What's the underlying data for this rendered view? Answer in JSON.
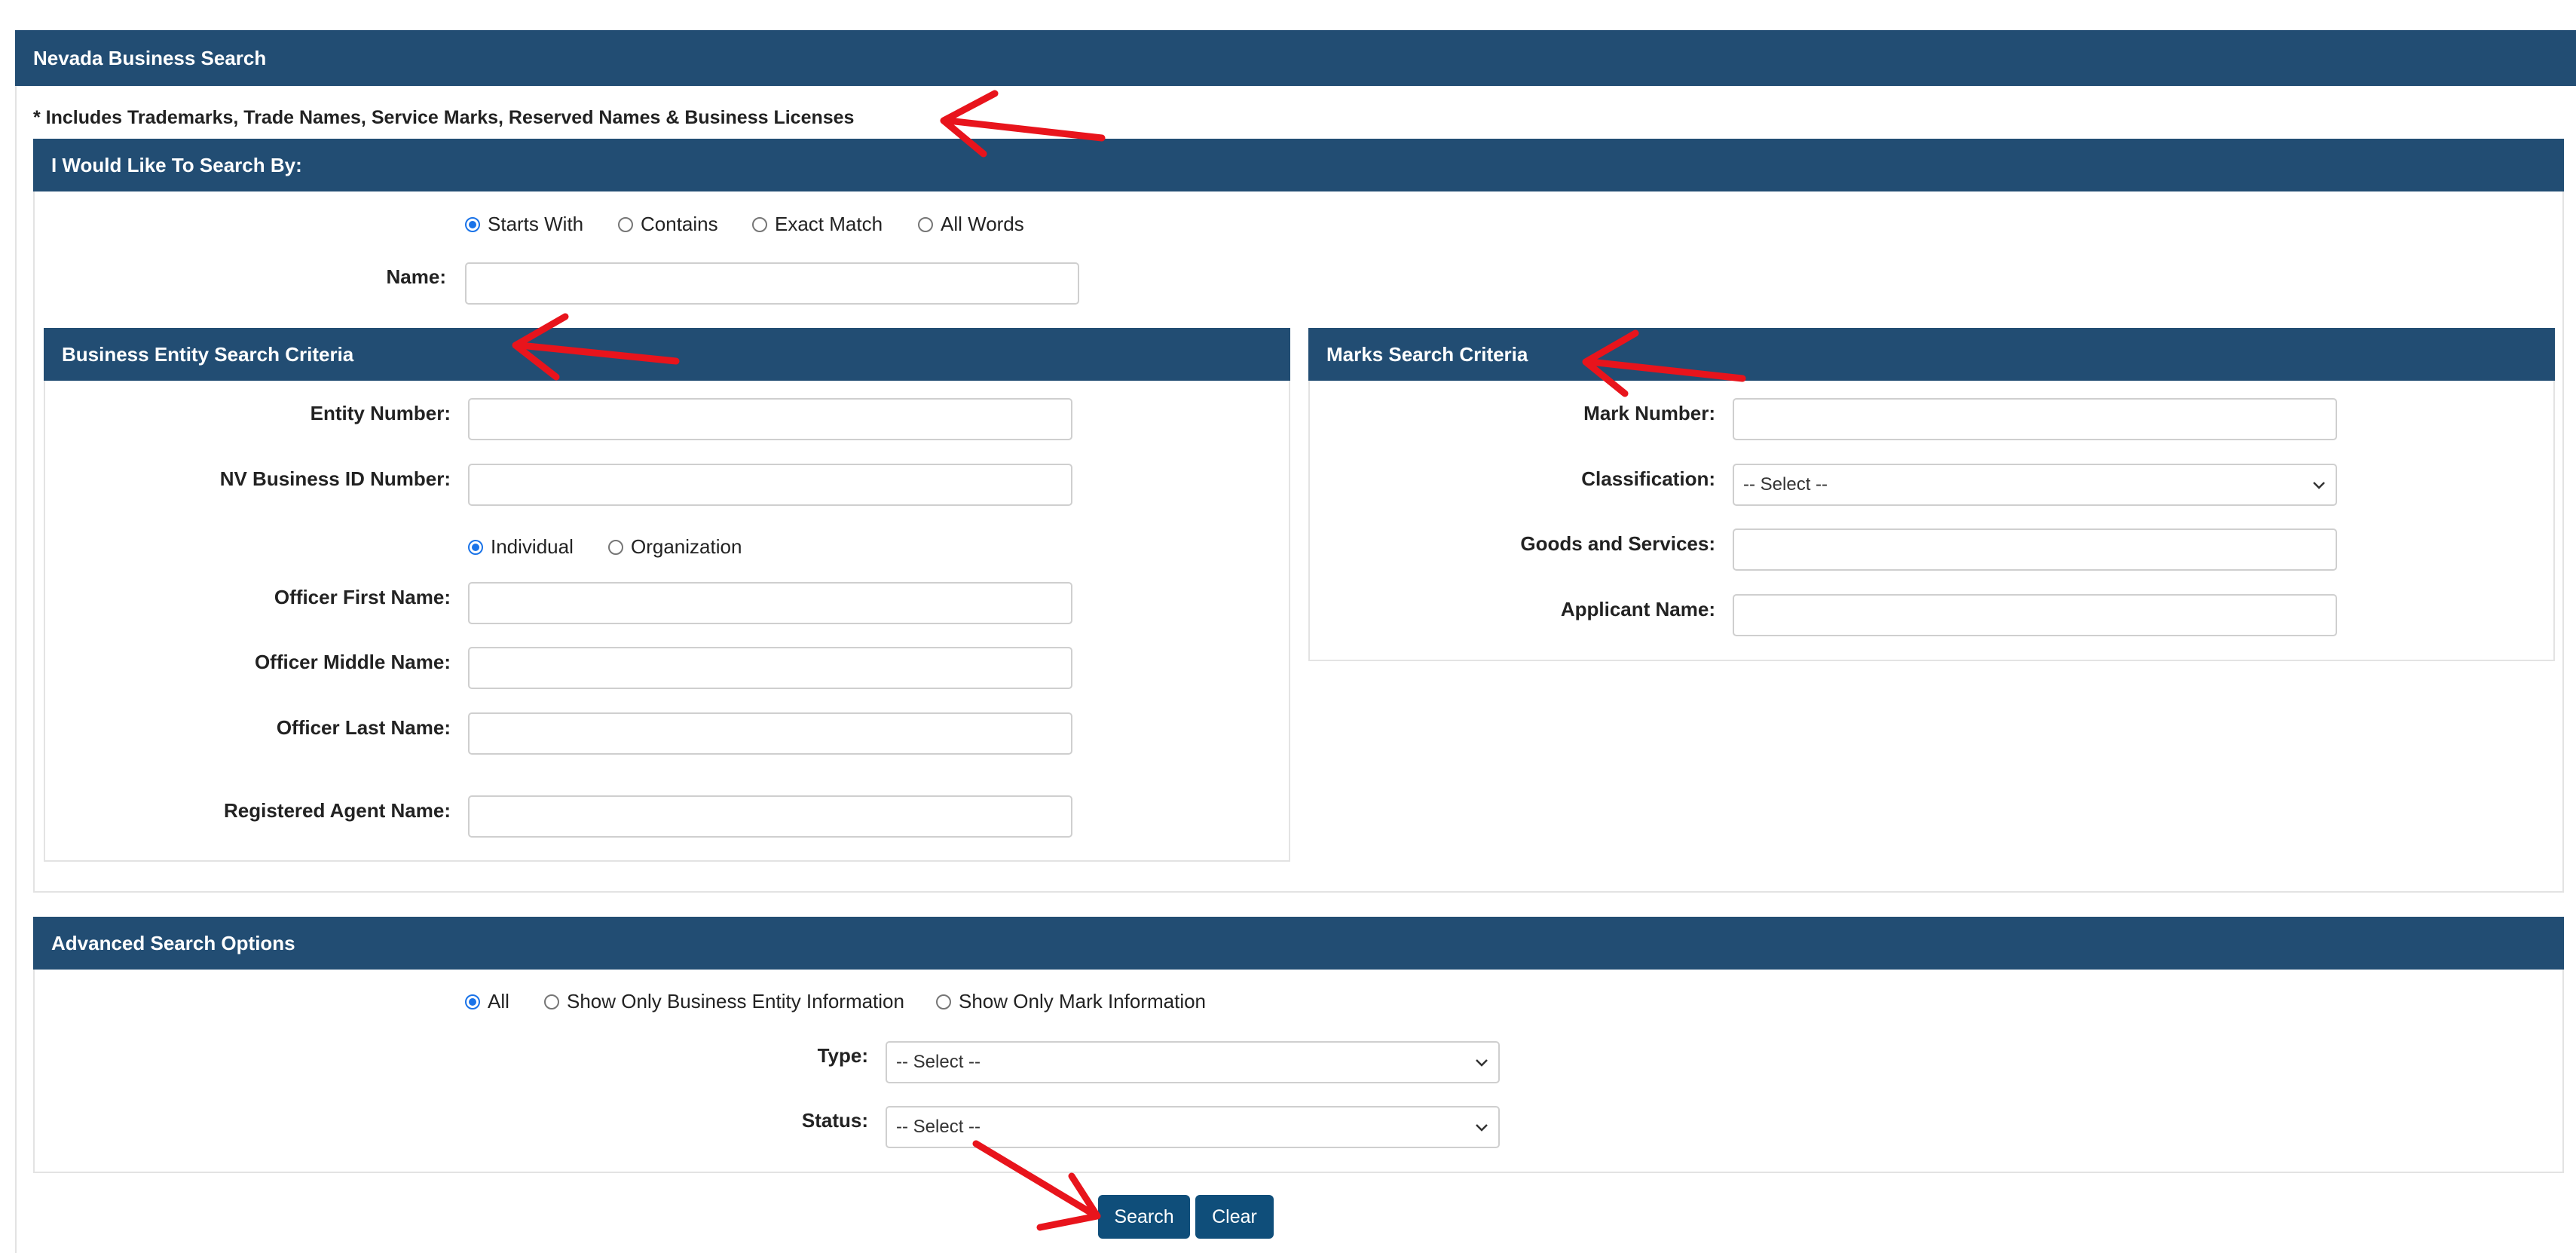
{
  "page": {
    "title": "Nevada Business Search",
    "note": "* Includes Trademarks, Trade Names, Service Marks, Reserved Names & Business Licenses"
  },
  "search_by": {
    "title": "I Would Like To Search By:",
    "match_options": [
      "Starts With",
      "Contains",
      "Exact Match",
      "All Words"
    ],
    "selected_match": "Starts With",
    "name_label": "Name:",
    "name_value": ""
  },
  "entity": {
    "title": "Business Entity Search Criteria",
    "entity_number_label": "Entity Number:",
    "nv_id_label": "NV Business ID Number:",
    "officer_type_options": [
      "Individual",
      "Organization"
    ],
    "selected_officer_type": "Individual",
    "officer_first_label": "Officer First Name:",
    "officer_middle_label": "Officer Middle Name:",
    "officer_last_label": "Officer Last Name:",
    "agent_label": "Registered Agent Name:"
  },
  "marks": {
    "title": "Marks Search Criteria",
    "mark_number_label": "Mark Number:",
    "classification_label": "Classification:",
    "classification_value": "-- Select --",
    "goods_label": "Goods and Services:",
    "applicant_label": "Applicant Name:"
  },
  "advanced": {
    "title": "Advanced Search Options",
    "show_options": [
      "All",
      "Show Only Business Entity Information",
      "Show Only Mark Information"
    ],
    "selected_show": "All",
    "type_label": "Type:",
    "type_value": "-- Select --",
    "status_label": "Status:",
    "status_value": "-- Select --"
  },
  "actions": {
    "search_label": "Search",
    "clear_label": "Clear"
  },
  "colors": {
    "header_bg": "#224d73",
    "button_bg": "#0f4e7a",
    "annotation_arrow": "#e8141c"
  },
  "icons": [
    "chevron-down-icon",
    "annotation-arrow-icon"
  ]
}
